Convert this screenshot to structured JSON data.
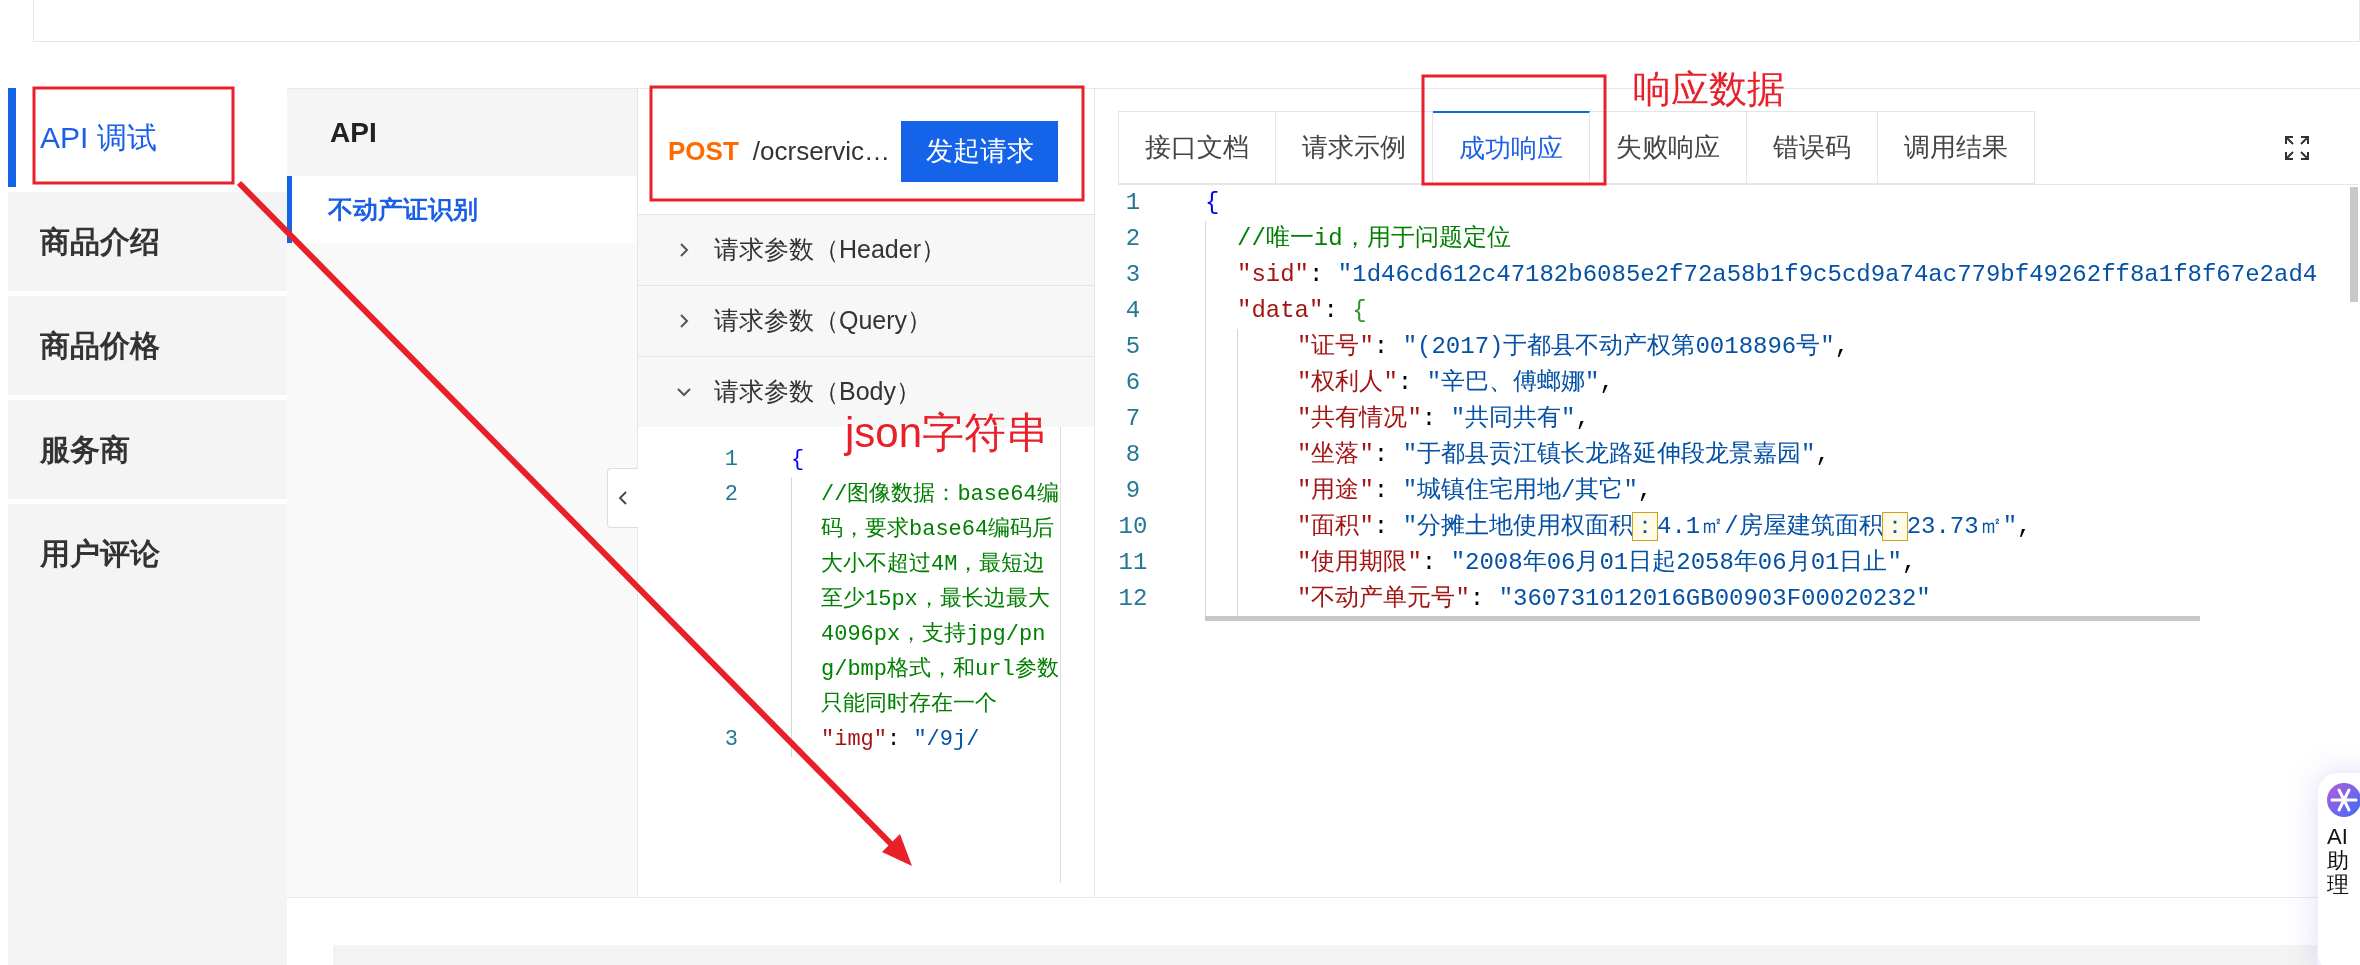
{
  "nav": {
    "items": [
      {
        "label": "API 调试",
        "selected": true
      },
      {
        "label": "商品介绍",
        "selected": false
      },
      {
        "label": "商品价格",
        "selected": false
      },
      {
        "label": "服务商",
        "selected": false
      },
      {
        "label": "用户评论",
        "selected": false
      }
    ]
  },
  "api_list": {
    "title": "API",
    "items": [
      {
        "label": "不动产证识别",
        "selected": true
      }
    ]
  },
  "request": {
    "method": "POST",
    "path": "/ocrservic…",
    "send_button": "发起请求",
    "sections": [
      {
        "label": "请求参数（Header）",
        "expanded": false
      },
      {
        "label": "请求参数（Query）",
        "expanded": false
      },
      {
        "label": "请求参数（Body）",
        "expanded": true
      }
    ],
    "annotation": "json字符串",
    "body_code": [
      {
        "number": "1",
        "tokens": [
          {
            "kind": "b1",
            "text": "{"
          }
        ],
        "children": [
          {
            "number": "2",
            "tokens": [
              {
                "kind": "c",
                "text": "//图像数据：base64编码，要求base64编码后大小不超过4M，最短边至少15px，最长边最大4096px，支持jpg/png/bmp格式，和url参数只能同时存在一个"
              }
            ]
          },
          {
            "number": "3",
            "tokens": [
              {
                "kind": "k",
                "text": "\"img\""
              },
              {
                "kind": "p",
                "text": ": "
              },
              {
                "kind": "s",
                "text": "\"/9j/"
              }
            ]
          }
        ]
      }
    ]
  },
  "response": {
    "annotation": "响应数据",
    "tabs": [
      {
        "label": "接口文档",
        "selected": false
      },
      {
        "label": "请求示例",
        "selected": false
      },
      {
        "label": "成功响应",
        "selected": true
      },
      {
        "label": "失败响应",
        "selected": false
      },
      {
        "label": "错误码",
        "selected": false
      },
      {
        "label": "调用结果",
        "selected": false
      }
    ],
    "code": [
      {
        "number": "1",
        "tokens": [
          {
            "kind": "b1",
            "text": "{"
          }
        ],
        "children": [
          {
            "number": "2",
            "tokens": [
              {
                "kind": "c",
                "text": "//唯一id，用于问题定位"
              }
            ]
          },
          {
            "number": "3",
            "tokens": [
              {
                "kind": "k",
                "text": "\"sid\""
              },
              {
                "kind": "p",
                "text": ": "
              },
              {
                "kind": "s",
                "text": "\"1d46cd612c47182b6085e2f72a58b1f9c5cd9a74ac779bf49262ff8a1f8f67e2ad4"
              }
            ]
          },
          {
            "number": "4",
            "tokens": [
              {
                "kind": "k",
                "text": "\"data\""
              },
              {
                "kind": "p",
                "text": ": "
              },
              {
                "kind": "b2",
                "text": "{"
              }
            ],
            "children": [
              {
                "number": "5",
                "tokens": [
                  {
                    "kind": "k",
                    "text": "\"证号\""
                  },
                  {
                    "kind": "p",
                    "text": ": "
                  },
                  {
                    "kind": "s",
                    "text": "\"(2017)于都县不动产权第0018896号\""
                  },
                  {
                    "kind": "p",
                    "text": ","
                  }
                ]
              },
              {
                "number": "6",
                "tokens": [
                  {
                    "kind": "k",
                    "text": "\"权利人\""
                  },
                  {
                    "kind": "p",
                    "text": ": "
                  },
                  {
                    "kind": "s",
                    "text": "\"辛巴、傅螂娜\""
                  },
                  {
                    "kind": "p",
                    "text": ","
                  }
                ]
              },
              {
                "number": "7",
                "tokens": [
                  {
                    "kind": "k",
                    "text": "\"共有情况\""
                  },
                  {
                    "kind": "p",
                    "text": ": "
                  },
                  {
                    "kind": "s",
                    "text": "\"共同共有\""
                  },
                  {
                    "kind": "p",
                    "text": ","
                  }
                ]
              },
              {
                "number": "8",
                "tokens": [
                  {
                    "kind": "k",
                    "text": "\"坐落\""
                  },
                  {
                    "kind": "p",
                    "text": ": "
                  },
                  {
                    "kind": "s",
                    "text": "\"于都县贡江镇长龙路延伸段龙景嘉园\""
                  },
                  {
                    "kind": "p",
                    "text": ","
                  }
                ]
              },
              {
                "number": "9",
                "tokens": [
                  {
                    "kind": "k",
                    "text": "\"用途\""
                  },
                  {
                    "kind": "p",
                    "text": ": "
                  },
                  {
                    "kind": "s",
                    "text": "\"城镇住宅用地/其它\""
                  },
                  {
                    "kind": "p",
                    "text": ","
                  }
                ]
              },
              {
                "number": "10",
                "tokens": [
                  {
                    "kind": "k",
                    "text": "\"面积\""
                  },
                  {
                    "kind": "p",
                    "text": ": "
                  },
                  {
                    "kind": "s",
                    "text": "\"分摊土地使用权面积"
                  },
                  {
                    "kind": "h",
                    "text": "："
                  },
                  {
                    "kind": "s",
                    "text": "4.1㎡/房屋建筑面积"
                  },
                  {
                    "kind": "h",
                    "text": "："
                  },
                  {
                    "kind": "s",
                    "text": "23.73㎡\""
                  },
                  {
                    "kind": "p",
                    "text": ","
                  }
                ]
              },
              {
                "number": "11",
                "tokens": [
                  {
                    "kind": "k",
                    "text": "\"使用期限\""
                  },
                  {
                    "kind": "p",
                    "text": ": "
                  },
                  {
                    "kind": "s",
                    "text": "\"2008年06月01日起2058年06月01日止\""
                  },
                  {
                    "kind": "p",
                    "text": ","
                  }
                ]
              },
              {
                "number": "12",
                "tokens": [
                  {
                    "kind": "k",
                    "text": "\"不动产单元号\""
                  },
                  {
                    "kind": "p",
                    "text": ": "
                  },
                  {
                    "kind": "s",
                    "text": "\"360731012016GB00903F00020232\""
                  }
                ]
              }
            ]
          }
        ]
      }
    ]
  },
  "assistant": {
    "label": "AI助理"
  }
}
